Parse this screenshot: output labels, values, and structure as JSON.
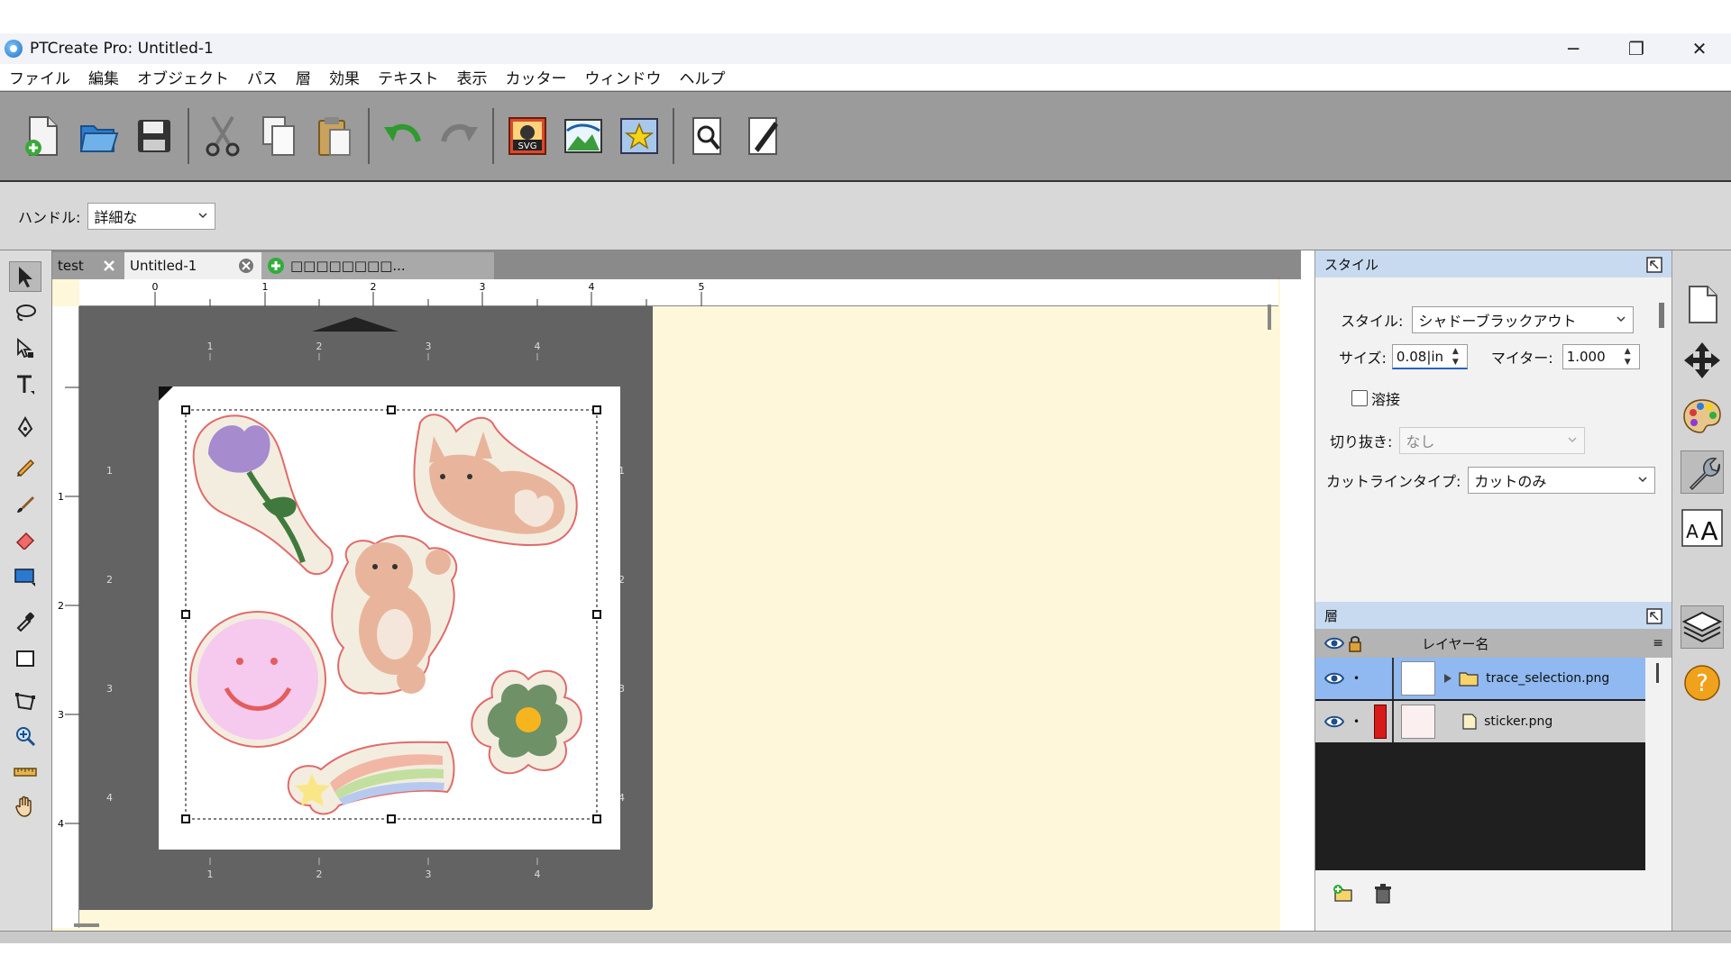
{
  "window": {
    "title": "PTCreate Pro: Untitled-1",
    "minimize": "─",
    "restore": "❐",
    "close": "✕"
  },
  "menu": [
    "ファイル",
    "編集",
    "オブジェクト",
    "パス",
    "層",
    "効果",
    "テキスト",
    "表示",
    "カッター",
    "ウィンドウ",
    "ヘルプ"
  ],
  "options": {
    "handle_label": "ハンドル:",
    "handle_value": "詳細な"
  },
  "tabs": {
    "test": "test",
    "untitled": "Untitled-1",
    "new": "□□□□□□□□..."
  },
  "rulers": {
    "top": [
      "0",
      "1",
      "2",
      "3",
      "4",
      "5"
    ],
    "left": [
      "1",
      "2",
      "3",
      "4"
    ],
    "mat_top": [
      "1",
      "2",
      "3",
      "4"
    ],
    "mat_side": [
      "1",
      "2",
      "3",
      "4"
    ]
  },
  "style_panel": {
    "header": "スタイル",
    "style_label": "スタイル:",
    "style_value": "シャドーブラックアウト",
    "size_label": "サイズ:",
    "size_value": "0.08|in",
    "miter_label": "マイター:",
    "miter_value": "1.000",
    "weld_label": "溶接",
    "clip_label": "切り抜き:",
    "clip_value": "なし",
    "cutline_label": "カットラインタイプ:",
    "cutline_value": "カットのみ"
  },
  "layers_panel": {
    "header": "層",
    "column_name": "レイヤー名",
    "layers": [
      {
        "name": "trace_selection.png",
        "selected": true
      },
      {
        "name": "sticker.png",
        "selected": false
      }
    ]
  },
  "colors": {
    "toolbar_bg": "#9b9b9b",
    "panel_header": "#c8daf0",
    "layer_selected": "#8fb9f0",
    "canvas_bg": "#fff7d9",
    "mat": "#636363"
  }
}
